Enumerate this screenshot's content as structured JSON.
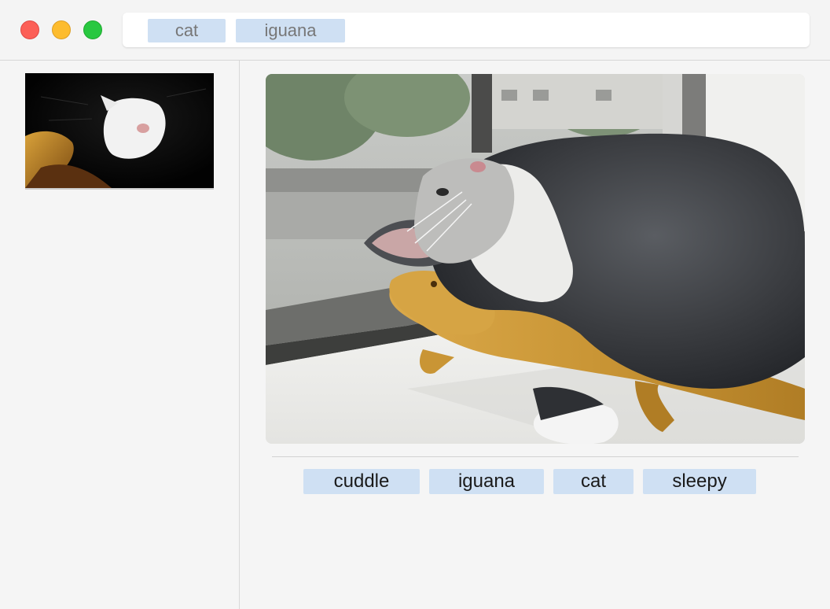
{
  "window": {
    "controls": [
      "close",
      "minimize",
      "zoom"
    ]
  },
  "search": {
    "tokens": [
      "cat",
      "iguana"
    ]
  },
  "sidebar": {
    "results": [
      {
        "thumbnail": "cat-and-iguana-thumbnail"
      }
    ]
  },
  "main": {
    "image": "cat-cuddling-iguana-photo",
    "tags": [
      "cuddle",
      "iguana",
      "cat",
      "sleepy"
    ]
  },
  "colors": {
    "token_bg": "#cfe0f3",
    "close": "#fc5f57",
    "minimize": "#fdbc2e",
    "zoom": "#28c840"
  }
}
